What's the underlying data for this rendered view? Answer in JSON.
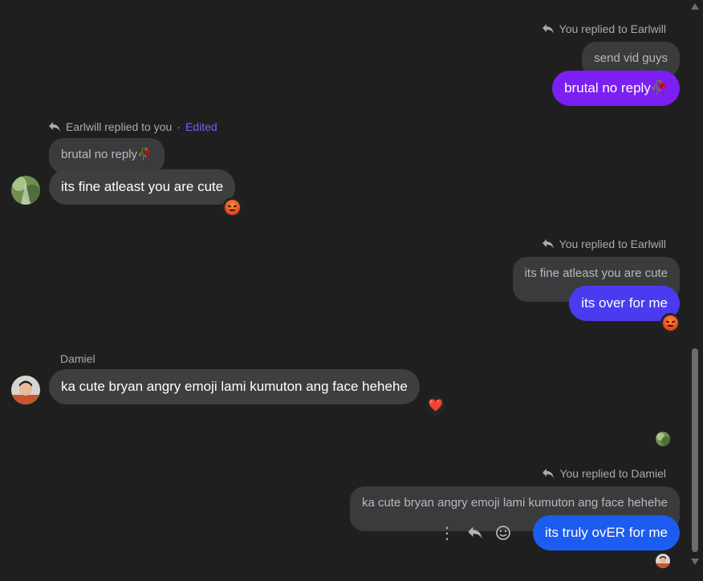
{
  "messages": [
    {
      "reply_header": "You replied to Earlwill",
      "quote": "send vid guys",
      "text": "brutal no reply🥀"
    },
    {
      "reply_header": "Earlwill replied to you",
      "edited": "Edited",
      "quote": "brutal no reply🥀",
      "text": "its fine atleast you are cute",
      "reaction": "angry-emoji"
    },
    {
      "reply_header": "You replied to Earlwill",
      "quote": "its fine atleast you are cute",
      "text": "its over for me",
      "reaction": "angry-emoji"
    },
    {
      "sender": "Damiel",
      "text": "ka cute bryan angry emoji lami kumuton ang face hehehe",
      "reaction": "❤️"
    },
    {
      "reply_header": "You replied to Damiel",
      "quote": "ka cute bryan angry emoji lami kumuton ang face hehehe",
      "text": "its truly ovER for me"
    }
  ],
  "separator": "·",
  "actions": {
    "more": "⋮",
    "reply_icon": "reply-icon",
    "emoji_icon": "smiley-icon"
  },
  "colors": {
    "background": "#1f1f1f",
    "bubble_gray": "#3e3f41",
    "bubble_purple": "#7b1ff2",
    "bubble_indigo": "#4b3bf0",
    "bubble_blue": "#1d5cf0",
    "edited_link": "#6b63ff"
  },
  "scrollbar": {
    "position_fraction": 0.6
  }
}
